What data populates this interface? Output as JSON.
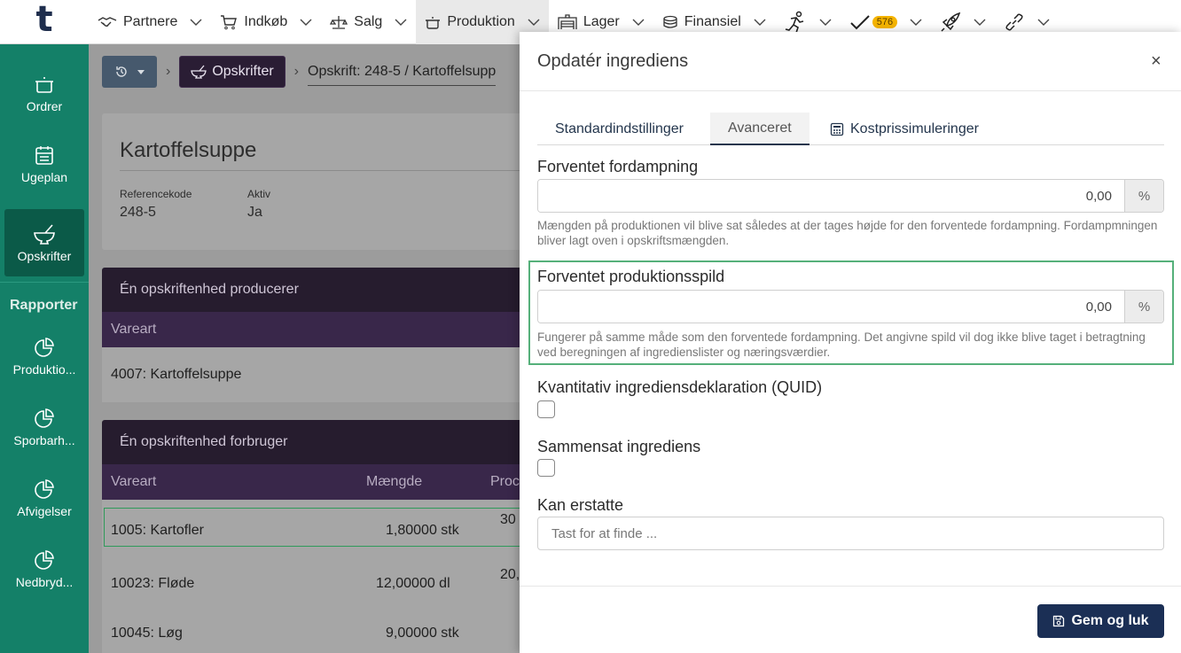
{
  "app": {
    "logo_letter": "t"
  },
  "topnav": {
    "items": [
      {
        "label": "Partnere",
        "icon": "handshake-icon"
      },
      {
        "label": "Indkøb",
        "icon": "cart-icon"
      },
      {
        "label": "Salg",
        "icon": "scale-icon"
      },
      {
        "label": "Produktion",
        "icon": "pot-icon"
      },
      {
        "label": "Lager",
        "icon": "warehouse-icon"
      },
      {
        "label": "Finansiel",
        "icon": "coins-icon"
      }
    ],
    "tasks_badge": "576"
  },
  "sidebar": {
    "items": [
      {
        "label": "Ordrer",
        "icon": "pot-icon"
      },
      {
        "label": "Ugeplan",
        "icon": "calendar-icon"
      },
      {
        "label": "Opskrifter",
        "icon": "mortar-icon"
      }
    ],
    "reports_heading": "Rapporter",
    "reports": [
      {
        "label": "Produktio...",
        "icon": "pie-chart-icon"
      },
      {
        "label": "Sporbarh...",
        "icon": "pie-chart-icon"
      },
      {
        "label": "Afvigelser",
        "icon": "pie-chart-icon"
      },
      {
        "label": "Nedbryd...",
        "icon": "pie-chart-icon"
      }
    ]
  },
  "breadcrumb": {
    "recipes_label": "Opskrifter",
    "current": "Opskrift: 248-5 / Kartoffelsupp"
  },
  "recipe": {
    "title": "Kartoffelsuppe",
    "reference_label": "Referencekode",
    "reference_value": "248-5",
    "active_label": "Aktiv",
    "active_value": "Ja"
  },
  "produces": {
    "heading": "Én opskriftenhed producerer",
    "col_item": "Vareart",
    "rows": [
      {
        "item": "4007: Kartoffelsuppe"
      }
    ]
  },
  "consumes": {
    "heading": "Én opskriftenhed forbruger",
    "col_item": "Vareart",
    "col_qty": "Mængde",
    "col_prod": "Proc",
    "rows": [
      {
        "item": "1005: Kartofler",
        "qty": "1,80000 stk",
        "prod": "30"
      },
      {
        "item": "10023: Fløde",
        "qty": "12,00000 dl",
        "prod": "20,"
      },
      {
        "item": "10045: Løg",
        "qty": "9,00000 stk",
        "prod": ""
      }
    ]
  },
  "modal": {
    "title": "Opdatér ingrediens",
    "close": "×",
    "tabs": [
      {
        "label": "Standardindstillinger"
      },
      {
        "label": "Avanceret"
      },
      {
        "label": "Kostprissimuleringer",
        "icon": "calculator-icon"
      }
    ],
    "evaporation": {
      "label": "Forventet fordampning",
      "value": "0,00",
      "unit": "%",
      "help": "Mængden på produktionen vil blive sat således at der tages højde for den forventede fordampning. Fordampmningen bliver lagt oven i opskriftsmængden."
    },
    "waste": {
      "label": "Forventet produktionsspild",
      "value": "0,00",
      "unit": "%",
      "help": "Fungerer på samme måde som den forventede fordampning. Det angivne spild vil dog ikke blive taget i betragtning ved beregningen af ingredienslister og næringsværdier."
    },
    "quid": {
      "label": "Kvantitativ ingrediensdeklaration (QUID)",
      "checked": false
    },
    "composite": {
      "label": "Sammensat ingrediens",
      "checked": false
    },
    "replaces": {
      "label": "Kan erstatte",
      "placeholder": "Tast for at finde ..."
    },
    "save_label": "Gem og luk"
  }
}
